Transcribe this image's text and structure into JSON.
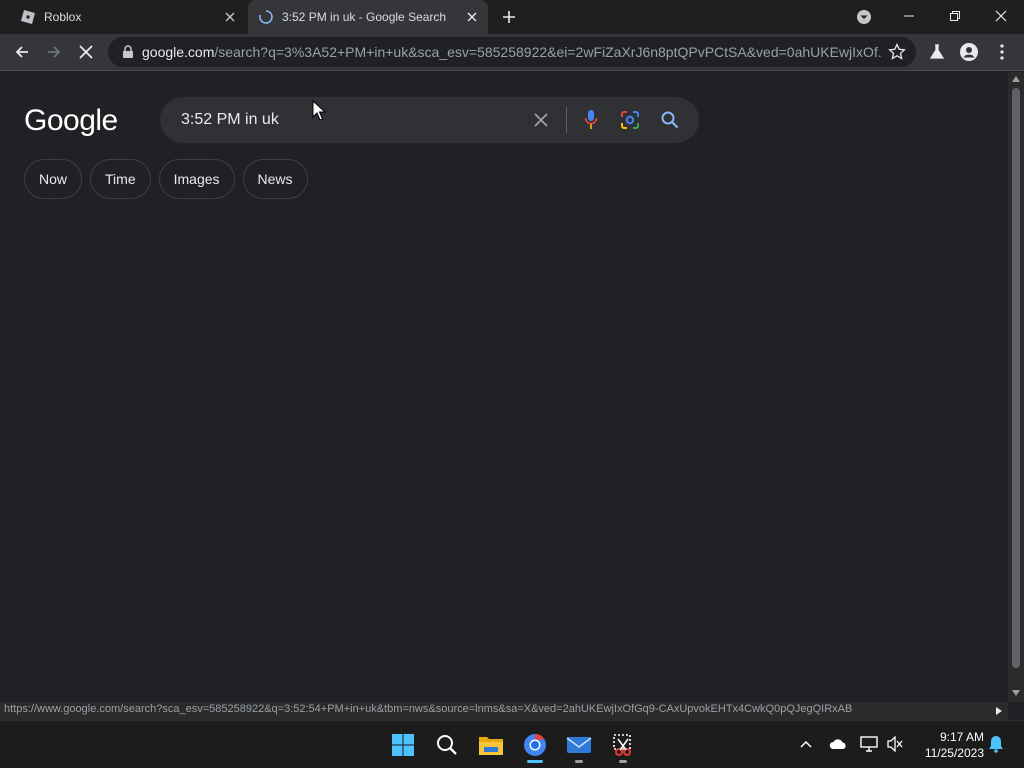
{
  "browser": {
    "tabs": [
      {
        "title": "Roblox",
        "icon": "roblox-icon",
        "active": false
      },
      {
        "title": "3:52 PM in uk - Google Search",
        "icon": "loading-spinner-icon",
        "active": true
      }
    ],
    "url_host": "google.com",
    "url_rest": "/search?q=3%3A52+PM+in+uk&sca_esv=585258922&ei=2wFiZaXrJ6n8ptQPvPCtSA&ved=0ahUKEwjIxOf...",
    "status_url": "https://www.google.com/search?sca_esv=585258922&q=3:52:54+PM+in+uk&tbm=nws&source=lnms&sa=X&ved=2ahUKEwjIxOfGq9-CAxUpvokEHTx4CwkQ0pQJegQIRxAB"
  },
  "google": {
    "logo": "Google",
    "query": "3:52 PM in uk",
    "chips": [
      "Now",
      "Time",
      "Images",
      "News"
    ]
  },
  "taskbar": {
    "apps": [
      "windows-start-icon",
      "search-icon",
      "file-explorer-icon",
      "chrome-icon",
      "mail-icon",
      "snipping-tool-icon"
    ],
    "time": "9:17 AM",
    "date": "11/25/2023"
  },
  "colors": {
    "page_bg": "#202124",
    "searchbox_bg": "#303134",
    "accent_blue": "#8ab4f8",
    "taskbar_accent": "#4cc2ff"
  }
}
